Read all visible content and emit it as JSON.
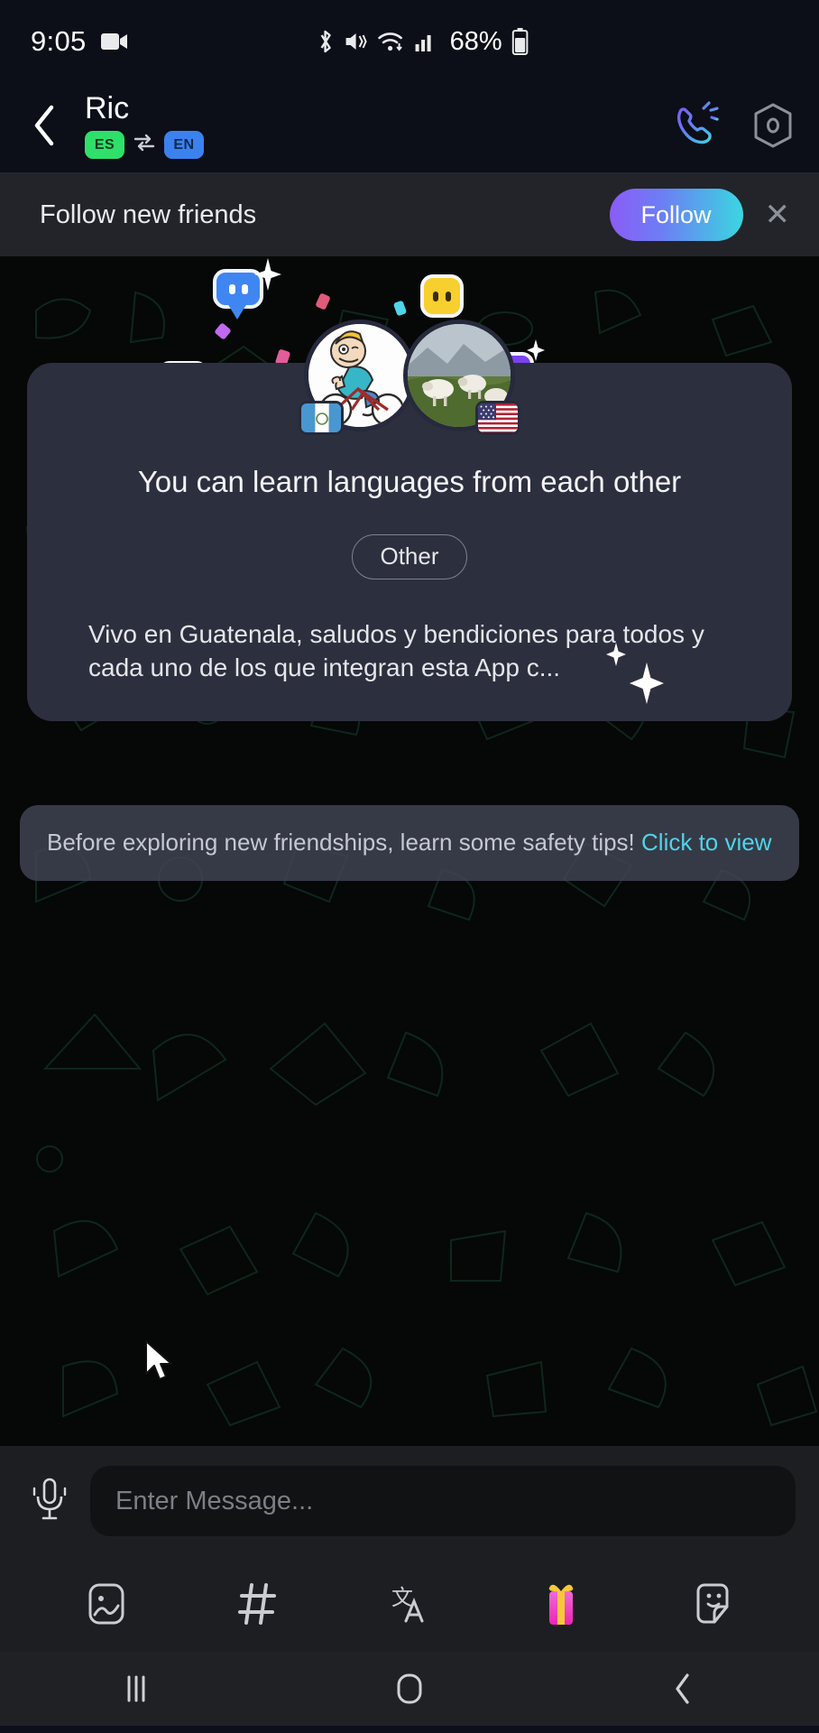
{
  "status_bar": {
    "time": "9:05",
    "battery_percent": "68%",
    "icons": [
      "video-recording-icon",
      "bluetooth-icon",
      "mute-vibrate-icon",
      "wifi-icon",
      "cellular-signal-icon",
      "battery-icon"
    ]
  },
  "header": {
    "back_icon": "back-chevron-icon",
    "contact_name": "Ric",
    "lang_from": "ES",
    "lang_to": "EN",
    "swap_icon": "swap-arrows-icon",
    "call_icon": "phone-call-icon",
    "settings_icon": "chat-settings-icon"
  },
  "follow_banner": {
    "text": "Follow new friends",
    "button_label": "Follow",
    "close_icon": "close-icon",
    "gradient_start": "#8b5cf6",
    "gradient_end": "#3ad6e0"
  },
  "profile_card": {
    "title": "You can learn languages from each other",
    "tag": "Other",
    "bio": "Vivo  en Guatenala,  saludos y bendiciones para todos y cada uno de los que integran esta App c...",
    "avatar_left_flag": "guatemala-flag",
    "avatar_right_flag": "usa-flag"
  },
  "safety_tip": {
    "text": "Before exploring new friendships, learn some safety tips! ",
    "link_text": "Click to view",
    "link_color": "#4fd4e8"
  },
  "composer": {
    "mic_icon": "microphone-icon",
    "placeholder": "Enter Message...",
    "value": ""
  },
  "toolbar": {
    "items": [
      {
        "name": "gallery-icon",
        "label": "Photo"
      },
      {
        "name": "hashtag-icon",
        "label": "Topic"
      },
      {
        "name": "translate-icon",
        "label": "Translate"
      },
      {
        "name": "gift-icon",
        "label": "Gift"
      },
      {
        "name": "sticker-icon",
        "label": "Sticker"
      }
    ]
  },
  "nav_bar": {
    "recents_icon": "recents-icon",
    "home_icon": "home-icon",
    "back_icon": "android-back-icon"
  }
}
